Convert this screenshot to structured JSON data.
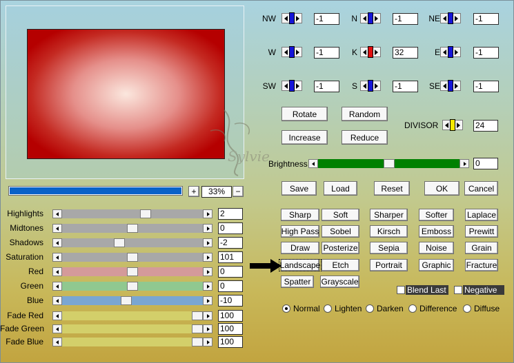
{
  "kernel": {
    "cells": [
      {
        "id": "nw",
        "label": "NW",
        "value": "-1",
        "knob": "#1515d8"
      },
      {
        "id": "n",
        "label": "N",
        "value": "-1",
        "knob": "#1515d8"
      },
      {
        "id": "ne",
        "label": "NE",
        "value": "-1",
        "knob": "#1515d8"
      },
      {
        "id": "w",
        "label": "W",
        "value": "-1",
        "knob": "#1515d8"
      },
      {
        "id": "k",
        "label": "K",
        "value": "32",
        "knob": "#e01010"
      },
      {
        "id": "e",
        "label": "E",
        "value": "-1",
        "knob": "#1515d8"
      },
      {
        "id": "sw",
        "label": "SW",
        "value": "-1",
        "knob": "#1515d8"
      },
      {
        "id": "s",
        "label": "S",
        "value": "-1",
        "knob": "#1515d8"
      },
      {
        "id": "se",
        "label": "SE",
        "value": "-1",
        "knob": "#1515d8"
      }
    ],
    "divisor": {
      "label": "DIVISOR",
      "value": "24",
      "knob": "#f5e800"
    },
    "rotate": "Rotate",
    "random": "Random",
    "increase": "Increase",
    "reduce": "Reduce"
  },
  "brightness": {
    "label": "Brightness",
    "value": "0",
    "level": 0.5,
    "color": "#008000"
  },
  "zoom": {
    "plus": "+",
    "value": "33%",
    "minus": "−",
    "progress": 1.0
  },
  "actions": {
    "save": "Save",
    "load": "Load",
    "reset": "Reset",
    "ok": "OK",
    "cancel": "Cancel"
  },
  "adjust": [
    {
      "id": "highlights",
      "label": "Highlights",
      "value": "2",
      "level": 0.6,
      "color": "#a8a8a8"
    },
    {
      "id": "midtones",
      "label": "Midtones",
      "value": "0",
      "level": 0.5,
      "color": "#a8a8a8"
    },
    {
      "id": "shadows",
      "label": "Shadows",
      "value": "-2",
      "level": 0.4,
      "color": "#a8a8a8"
    },
    {
      "id": "saturation",
      "label": "Saturation",
      "value": "101",
      "level": 0.5,
      "color": "#a8a8a8"
    },
    {
      "id": "red",
      "label": "Red",
      "value": "0",
      "level": 0.5,
      "color": "#d49a9a"
    },
    {
      "id": "green",
      "label": "Green",
      "value": "0",
      "level": 0.5,
      "color": "#90c890"
    },
    {
      "id": "blue",
      "label": "Blue",
      "value": "-10",
      "level": 0.45,
      "color": "#7aa6d2"
    },
    {
      "id": "fade_red",
      "label": "Fade Red",
      "value": "100",
      "level": 1.0,
      "color": "#d3cf6a"
    },
    {
      "id": "fade_green",
      "label": "Fade Green",
      "value": "100",
      "level": 1.0,
      "color": "#d3cf6a"
    },
    {
      "id": "fade_blue",
      "label": "Fade Blue",
      "value": "100",
      "level": 1.0,
      "color": "#d3cf6a"
    }
  ],
  "presets": [
    {
      "id": "sharp",
      "label": "Sharp"
    },
    {
      "id": "soft",
      "label": "Soft"
    },
    {
      "id": "sharper",
      "label": "Sharper"
    },
    {
      "id": "softer",
      "label": "Softer"
    },
    {
      "id": "laplace",
      "label": "Laplace"
    },
    {
      "id": "highpass",
      "label": "High Pass"
    },
    {
      "id": "sobel",
      "label": "Sobel"
    },
    {
      "id": "kirsch",
      "label": "Kirsch"
    },
    {
      "id": "emboss",
      "label": "Emboss"
    },
    {
      "id": "prewitt",
      "label": "Prewitt"
    },
    {
      "id": "draw",
      "label": "Draw"
    },
    {
      "id": "posterize",
      "label": "Posterize"
    },
    {
      "id": "sepia",
      "label": "Sepia"
    },
    {
      "id": "noise",
      "label": "Noise"
    },
    {
      "id": "grain",
      "label": "Grain"
    },
    {
      "id": "landscape",
      "label": "Landscape"
    },
    {
      "id": "etch",
      "label": "Etch"
    },
    {
      "id": "portrait",
      "label": "Portrait"
    },
    {
      "id": "graphic",
      "label": "Graphic"
    },
    {
      "id": "fracture",
      "label": "Fracture"
    },
    {
      "id": "spatter",
      "label": "Spatter"
    },
    {
      "id": "grayscale",
      "label": "Grayscale"
    }
  ],
  "options": {
    "blend_last": "Blend Last",
    "negative": "Negative"
  },
  "blend_modes": [
    {
      "id": "normal",
      "label": "Normal",
      "selected": true
    },
    {
      "id": "lighten",
      "label": "Lighten",
      "selected": false
    },
    {
      "id": "darken",
      "label": "Darken",
      "selected": false
    },
    {
      "id": "difference",
      "label": "Difference",
      "selected": false
    },
    {
      "id": "diffuse",
      "label": "Diffuse",
      "selected": false
    }
  ],
  "watermark": "Sylvie",
  "colors": {
    "accent": "#0a62c8",
    "preview_edge": "#b50000",
    "preview_center": "#fbe7de"
  }
}
